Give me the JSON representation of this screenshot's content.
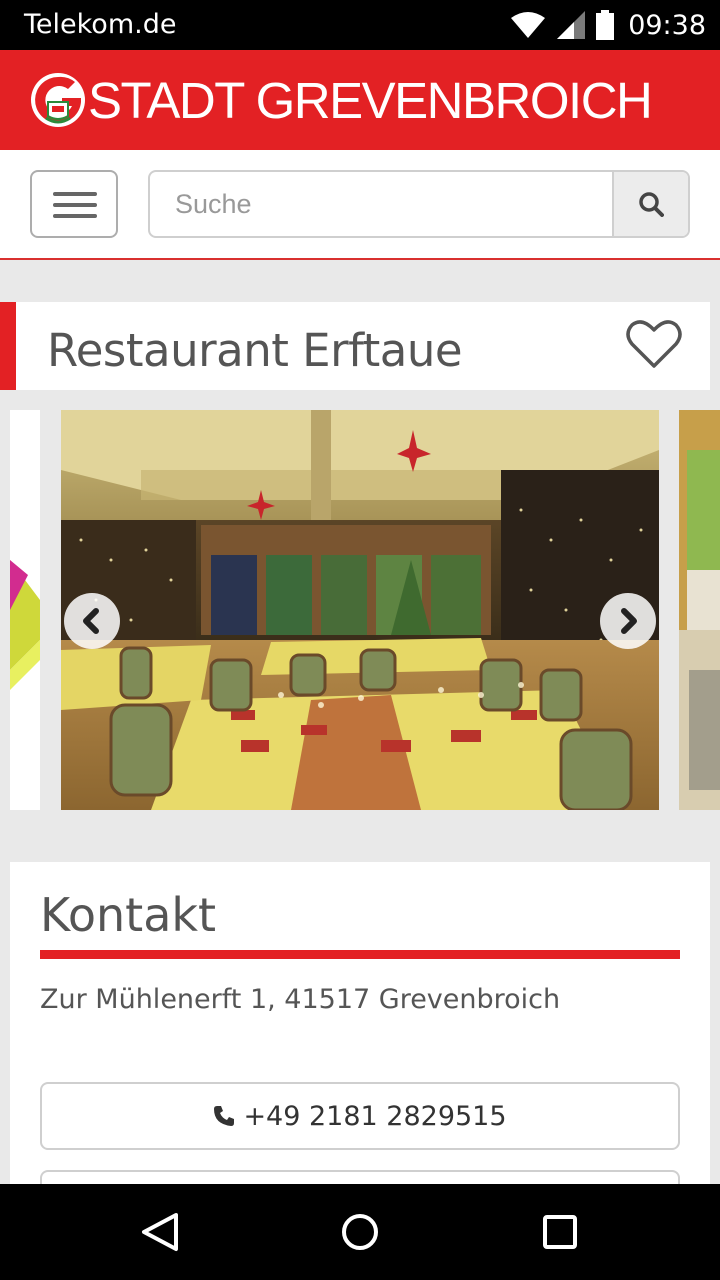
{
  "status_bar": {
    "carrier": "Telekom.de",
    "time": "09:38",
    "icons": [
      "wifi-icon",
      "signal-icon",
      "battery-icon"
    ]
  },
  "header": {
    "brand": "STADT GREVENBROICH",
    "logo_icon": "city-logo-icon"
  },
  "nav": {
    "menu_icon": "hamburger-icon",
    "search_placeholder": "Suche",
    "search_icon": "search-icon"
  },
  "place": {
    "title": "Restaurant Erftaue",
    "favorite_icon": "heart-icon"
  },
  "gallery": {
    "prev_icon": "chevron-left-icon",
    "next_icon": "chevron-right-icon"
  },
  "contact": {
    "heading": "Kontakt",
    "address": "Zur Mühlenerft 1, 41517 Grevenbroich",
    "phone": "+49 2181 2829515",
    "phone_icon": "phone-icon"
  },
  "system_nav": {
    "icons": [
      "back-icon",
      "home-icon",
      "recents-icon"
    ]
  },
  "colors": {
    "brand_red": "#e32124",
    "text_gray": "#555555"
  }
}
